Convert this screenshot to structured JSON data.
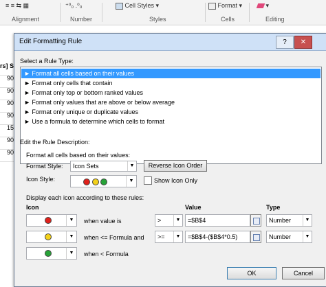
{
  "ribbon": {
    "align_icons": "≡ ≡ ⇆ ▦",
    "number_icons": "⁺⁰₀ .⁰₀",
    "cell_styles": "Cell Styles",
    "format": "Format",
    "groups": {
      "alignment": "Alignment",
      "number": "Number",
      "styles": "Styles",
      "cells": "Cells",
      "editing": "Editing"
    }
  },
  "sheet": {
    "header_cell": "rs] S",
    "cells": [
      "90",
      "90",
      "90",
      "90",
      "15",
      "90",
      "90"
    ]
  },
  "dialog": {
    "title": "Edit Formatting Rule",
    "help": "?",
    "close": "✕",
    "select_rule_type": "Select a Rule Type:",
    "rule_types": [
      "Format all cells based on their values",
      "Format only cells that contain",
      "Format only top or bottom ranked values",
      "Format only values that are above or below average",
      "Format only unique or duplicate values",
      "Use a formula to determine which cells to format"
    ],
    "edit_description": "Edit the Rule Description:",
    "desc_heading": "Format all cells based on their values:",
    "format_style_label": "Format Style:",
    "format_style_value": "Icon Sets",
    "reverse_icon_order": "Reverse Icon Order",
    "icon_style_label": "Icon Style:",
    "show_icon_only": "Show Icon Only",
    "display_rules": "Display each icon according to these rules:",
    "col_icon": "Icon",
    "col_value": "Value",
    "col_type": "Type",
    "rows": [
      {
        "color": "#e0211b",
        "condition": "when value is",
        "operator": ">",
        "value": "=$B$4",
        "type": "Number"
      },
      {
        "color": "#f3d11a",
        "condition": "when <= Formula and",
        "operator": ">=",
        "value": "=$B$4-($B$4*0.5)",
        "type": "Number"
      },
      {
        "color": "#27a338",
        "condition": "when < Formula",
        "operator": "",
        "value": "",
        "type": ""
      }
    ],
    "ok": "OK",
    "cancel": "Cancel"
  },
  "colors": {
    "selection": "#3399ff",
    "titlebar": "#cfe1f7"
  }
}
